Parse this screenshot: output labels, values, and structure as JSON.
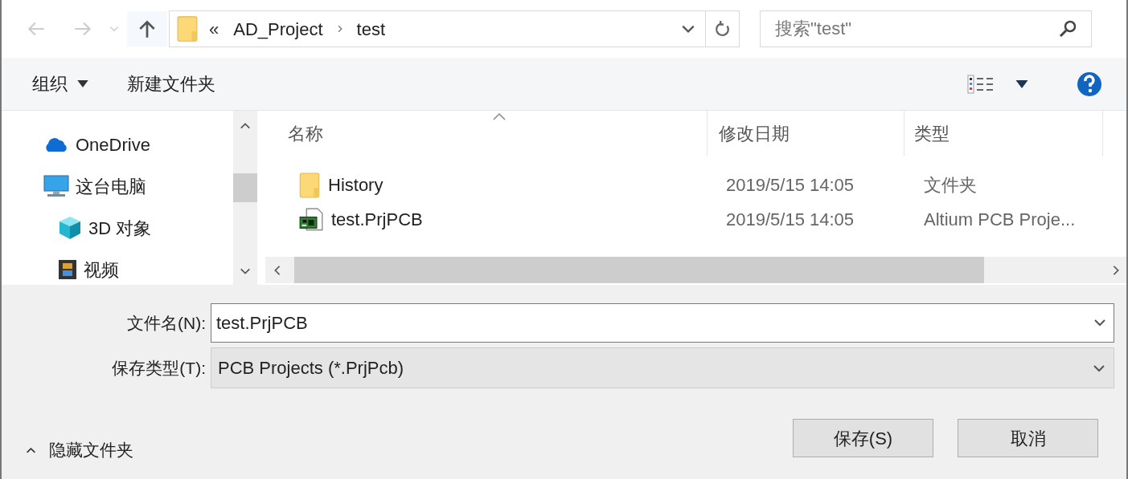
{
  "address": {
    "overflow": "«",
    "segments": [
      "AD_Project",
      "test"
    ]
  },
  "search": {
    "placeholder": "搜索\"test\""
  },
  "toolbar": {
    "organize": "组织",
    "new_folder": "新建文件夹"
  },
  "sidebar": {
    "items": [
      {
        "label": "OneDrive",
        "kind": "cloud"
      },
      {
        "label": "这台电脑",
        "kind": "pc",
        "children": [
          {
            "label": "3D 对象",
            "kind": "cube"
          },
          {
            "label": "视频",
            "kind": "video"
          }
        ]
      }
    ]
  },
  "table": {
    "columns": [
      "名称",
      "修改日期",
      "类型"
    ],
    "rows": [
      {
        "name": "History",
        "modified": "2019/5/15 14:05",
        "type": "文件夹",
        "kind": "folder"
      },
      {
        "name": "test.PrjPCB",
        "modified": "2019/5/15 14:05",
        "type": "Altium PCB Proje...",
        "kind": "pcb"
      }
    ]
  },
  "file_name": {
    "label": "文件名(N):",
    "value": "test.PrjPCB"
  },
  "save_type": {
    "label": "保存类型(T):",
    "value": "PCB Projects (*.PrjPcb)"
  },
  "hide_folders": "隐藏文件夹",
  "buttons": [
    "保存(S)",
    "取消"
  ]
}
